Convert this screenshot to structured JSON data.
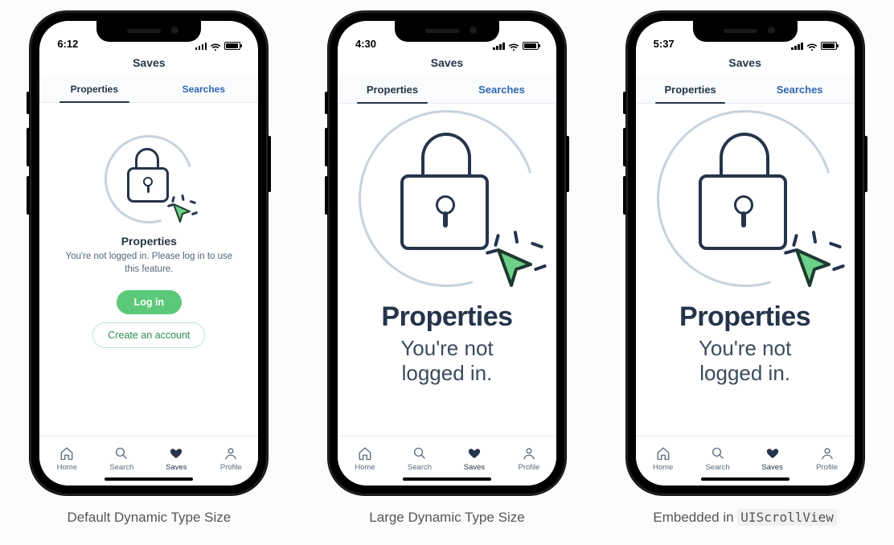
{
  "captions": {
    "default": "Default Dynamic Type Size",
    "large": "Large Dynamic Type Size",
    "scroll_prefix": "Embedded in ",
    "scroll_code": "UIScrollView"
  },
  "status": {
    "time_default": "6:12",
    "time_large": "4:30",
    "time_scroll": "5:37"
  },
  "nav": {
    "title": "Saves"
  },
  "tabs": {
    "properties": "Properties",
    "searches": "Searches"
  },
  "empty": {
    "heading": "Properties",
    "body_default": "You're not logged in. Please log in to use this feature.",
    "body_large_line1": "You're not",
    "body_large_line2": "logged in.",
    "login": "Log in",
    "create": "Create an account"
  },
  "tabbar": {
    "home": "Home",
    "search": "Search",
    "saves": "Saves",
    "profile": "Profile"
  }
}
